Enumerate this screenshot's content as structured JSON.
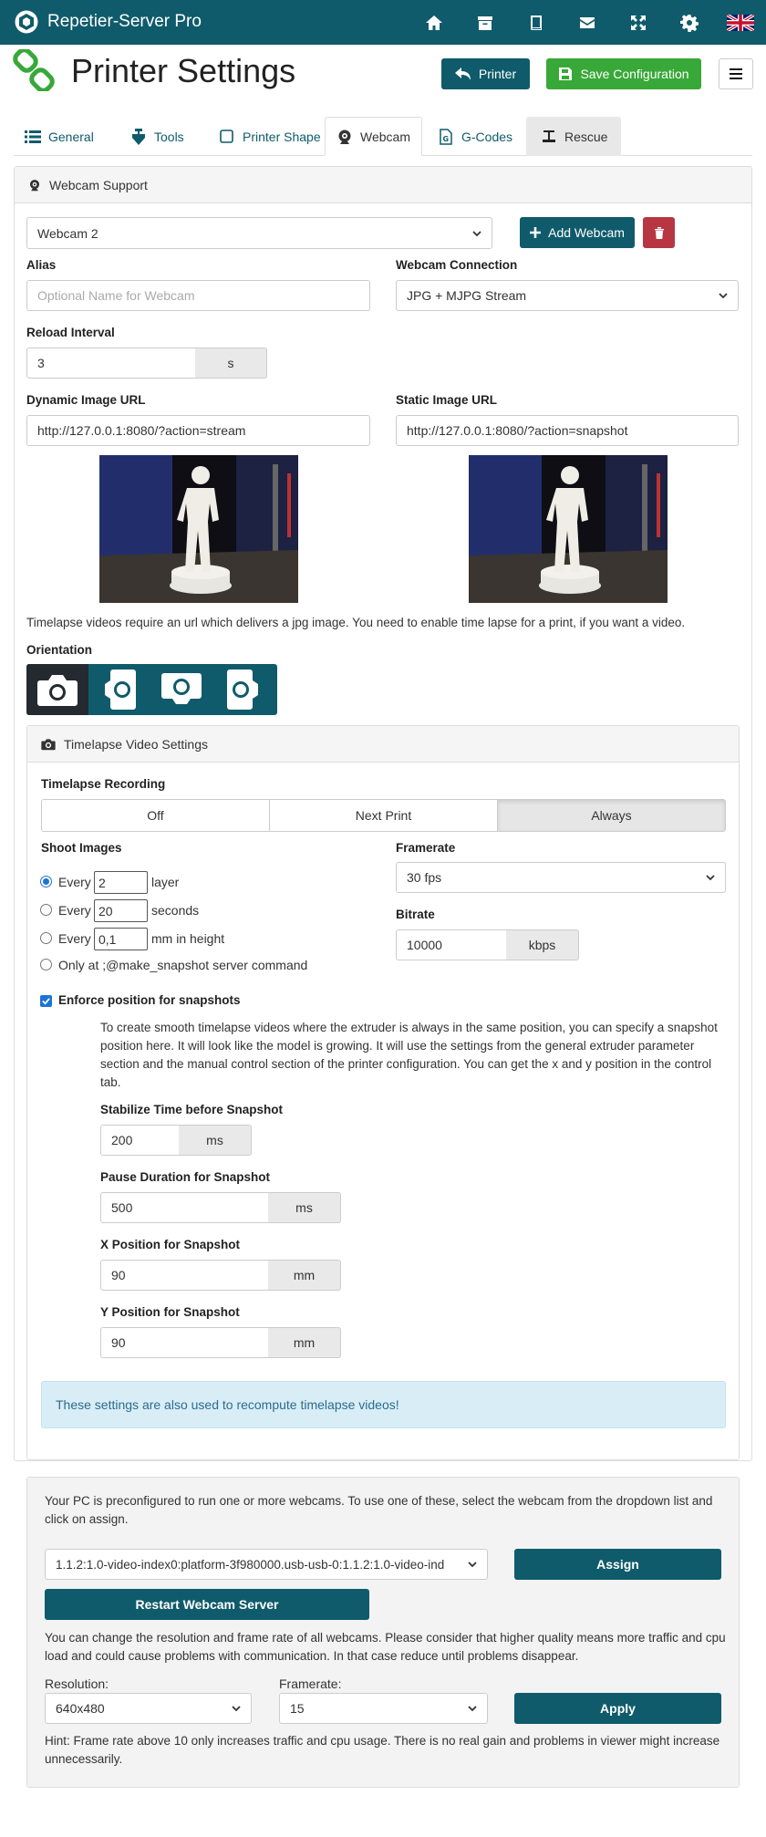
{
  "topbar": {
    "brand": "Repetier-Server Pro",
    "icons": [
      "home-icon",
      "archive-icon",
      "book-icon",
      "mail-icon",
      "fullscreen-icon",
      "gear-icon",
      "uk-flag-icon"
    ]
  },
  "header": {
    "title": "Printer Settings",
    "printer_label": "Printer",
    "save_label": "Save Configuration"
  },
  "tabs": [
    {
      "label": "General"
    },
    {
      "label": "Tools"
    },
    {
      "label": "Printer Shape"
    },
    {
      "label": "Webcam"
    },
    {
      "label": "G-Codes"
    },
    {
      "label": "Rescue"
    }
  ],
  "webcam": {
    "panel_title": "Webcam Support",
    "selected_webcam": "Webcam 2",
    "add_label": "Add Webcam",
    "alias_label": "Alias",
    "alias_placeholder": "Optional Name for Webcam",
    "connection_label": "Webcam Connection",
    "connection_value": "JPG + MJPG Stream",
    "reload_label": "Reload Interval",
    "reload_value": "3",
    "reload_unit": "s",
    "dynamic_label": "Dynamic Image URL",
    "dynamic_value": "http://127.0.0.1:8080/?action=stream",
    "static_label": "Static Image URL",
    "static_value": "http://127.0.0.1:8080/?action=snapshot",
    "timelapse_note": "Timelapse videos require an url which delivers a jpg image. You need to enable time lapse for a print, if you want a video.",
    "orientation_label": "Orientation"
  },
  "timelapse": {
    "panel_title": "Timelapse Video Settings",
    "recording_label": "Timelapse Recording",
    "options": [
      "Off",
      "Next Print",
      "Always"
    ],
    "active_option": "Always",
    "shoot_label": "Shoot Images",
    "every_label": "Every",
    "layer_value": "2",
    "layer_unit": "layer",
    "seconds_value": "20",
    "seconds_unit": "seconds",
    "mm_value": "0,1",
    "mm_unit": "mm in height",
    "only_at": "Only at ;@make_snapshot server command",
    "framerate_label": "Framerate",
    "framerate_value": "30 fps",
    "bitrate_label": "Bitrate",
    "bitrate_value": "10000",
    "bitrate_unit": "kbps",
    "enforce_label": "Enforce position for snapshots",
    "enforce_text": "To create smooth timelapse videos where the extruder is always in the same position, you can specify a snapshot position here. It will look like the model is growing. It will use the settings from the general extruder parameter section and the manual control section of the printer configuration. You can get the x and y position in the control tab.",
    "stabilize_label": "Stabilize Time before Snapshot",
    "stabilize_value": "200",
    "stabilize_unit": "ms",
    "pause_label": "Pause Duration for Snapshot",
    "pause_value": "500",
    "pause_unit": "ms",
    "x_label": "X Position for Snapshot",
    "x_value": "90",
    "x_unit": "mm",
    "y_label": "Y Position for Snapshot",
    "y_value": "90",
    "y_unit": "mm",
    "alert": "These settings are also used to recompute timelapse videos!"
  },
  "server": {
    "intro": "Your PC is preconfigured to run one or more webcams. To use one of these, select the webcam from the dropdown list and click on assign.",
    "device": "1.1.2:1.0-video-index0:platform-3f980000.usb-usb-0:1.1.2:1.0-video-ind",
    "assign_label": "Assign",
    "restart_label": "Restart Webcam Server",
    "quality_text": "You can change the resolution and frame rate of all webcams. Please consider that higher quality means more traffic and cpu load and could cause problems with communication. In that case reduce until problems disappear.",
    "resolution_label": "Resolution:",
    "resolution_value": "640x480",
    "framerate_label": "Framerate:",
    "framerate_value": "15",
    "apply_label": "Apply",
    "hint": "Hint: Frame rate above 10 only increases traffic and cpu usage. There is no real gain and problems in viewer might increase unnecessarily."
  }
}
